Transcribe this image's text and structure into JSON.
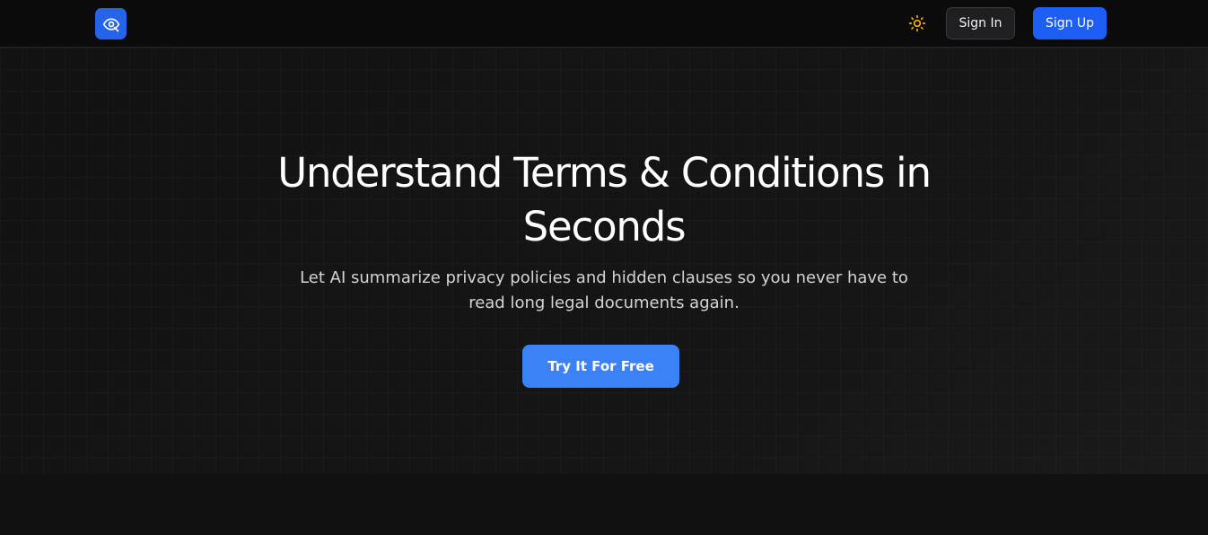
{
  "header": {
    "logo_icon": "eye-search-icon",
    "theme_toggle_icon": "sun-icon",
    "sign_in_label": "Sign In",
    "sign_up_label": "Sign Up"
  },
  "hero": {
    "title": "Understand Terms & Conditions in Seconds",
    "subtitle": "Let AI summarize privacy policies and hidden clauses so you never have to read long legal documents again.",
    "cta_label": "Try It For Free"
  },
  "colors": {
    "background": "#111111",
    "accent_blue": "#1d5ef5",
    "cta_blue": "#3b82f6",
    "sun_icon": "#f5b301"
  }
}
